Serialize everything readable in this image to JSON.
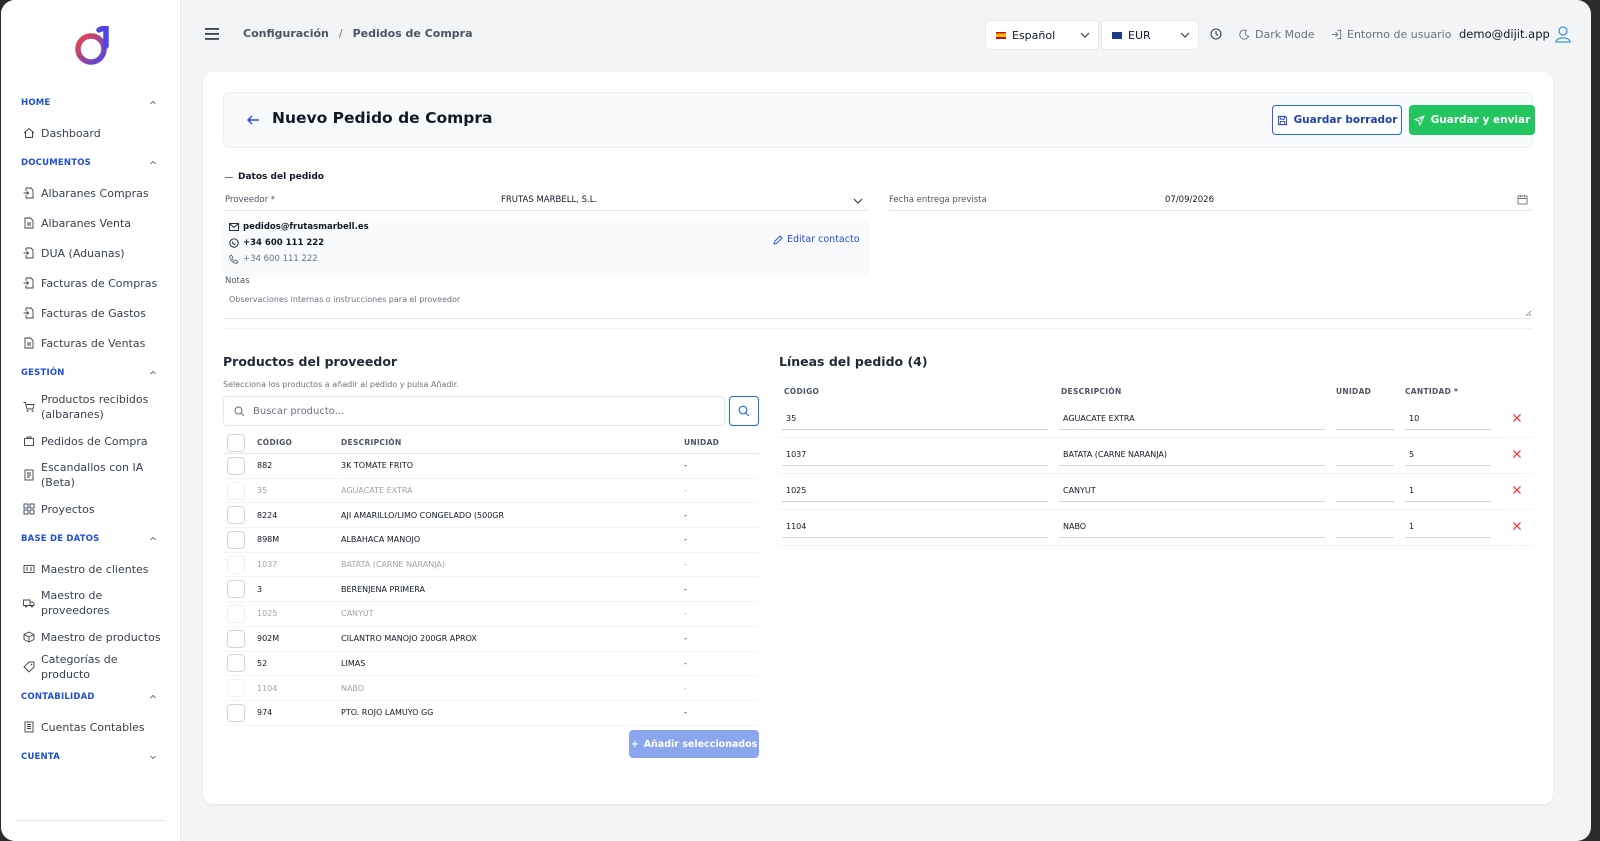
{
  "sidebar": {
    "sections": [
      {
        "title": "HOME",
        "chev": "up",
        "items": [
          {
            "label": "Dashboard",
            "icon": "home-icon"
          }
        ]
      },
      {
        "title": "DOCUMENTOS",
        "chev": "up",
        "items": [
          {
            "label": "Albaranes Compras",
            "icon": "document-in-icon"
          },
          {
            "label": "Albaranes Venta",
            "icon": "document-out-icon"
          },
          {
            "label": "DUA (Aduanas)",
            "icon": "document-in-icon"
          },
          {
            "label": "Facturas de Compras",
            "icon": "document-in-icon"
          },
          {
            "label": "Facturas de Gastos",
            "icon": "document-in-icon"
          },
          {
            "label": "Facturas de Ventas",
            "icon": "document-out-icon"
          }
        ]
      },
      {
        "title": "GESTIÓN",
        "chev": "up",
        "items": [
          {
            "label": "Productos recibidos (albaranes)",
            "icon": "cart-icon",
            "two": true
          },
          {
            "label": "Pedidos de Compra",
            "icon": "bag-icon"
          },
          {
            "label": "Escandallos con IA (Beta)",
            "icon": "list-icon",
            "two": true
          },
          {
            "label": "Proyectos",
            "icon": "grid-icon"
          }
        ]
      },
      {
        "title": "BASE DE DATOS",
        "chev": "up",
        "items": [
          {
            "label": "Maestro de clientes",
            "icon": "id-card-icon"
          },
          {
            "label": "Maestro de proveedores",
            "icon": "truck-icon",
            "two": true
          },
          {
            "label": "Maestro de productos",
            "icon": "box-icon"
          },
          {
            "label": "Categorías de producto",
            "icon": "tag-icon"
          }
        ]
      },
      {
        "title": "CONTABILIDAD",
        "chev": "up",
        "items": [
          {
            "label": "Cuentas Contables",
            "icon": "ledger-icon"
          }
        ]
      },
      {
        "title": "CUENTA",
        "chev": "down",
        "items": []
      }
    ]
  },
  "topbar": {
    "breadcrumb": [
      "Configuración",
      "Pedidos de Compra"
    ],
    "breadcrumb_sep": "/",
    "language": "Español",
    "currency": "EUR",
    "dark_mode": "Dark Mode",
    "user_env": "Entorno de usuario",
    "user": "demo@dijit.app"
  },
  "page": {
    "title": "Nuevo Pedido de Compra",
    "save_draft": "Guardar borrador",
    "save_send": "Guardar y enviar",
    "section_title": "Datos del pedido",
    "supplier_label": "Proveedor *",
    "supplier_value": "FRUTAS MARBELL, S.L.",
    "date_label": "Fecha entrega prevista",
    "date_value": "07/09/2026",
    "contact": {
      "email": "pedidos@frutasmarbell.es",
      "whatsapp": "+34 600 111 222",
      "phone": "+34 600 111 222",
      "edit": "Editar contacto"
    },
    "notes_label": "Notas",
    "notes_placeholder": "Observaciones internas o instrucciones para el proveedor"
  },
  "products": {
    "title": "Productos del proveedor",
    "subtitle": "Selecciona los productos a añadir al pedido y pulsa Añadir.",
    "search_placeholder": "Buscar producto...",
    "headers": {
      "code": "CÓDIGO",
      "description": "DESCRIPCIÓN",
      "unit": "UNIDAD"
    },
    "rows": [
      {
        "code": "882",
        "description": "3K TOMATE FRITO",
        "unit": "-",
        "disabled": false
      },
      {
        "code": "35",
        "description": "AGUACATE EXTRA",
        "unit": "-",
        "disabled": true
      },
      {
        "code": "8224",
        "description": "AJI AMARILLO/LIMO CONGELADO (500GR",
        "unit": "-",
        "disabled": false
      },
      {
        "code": "898M",
        "description": "ALBAHACA MANOJO",
        "unit": "-",
        "disabled": false
      },
      {
        "code": "1037",
        "description": "BATATA (CARNE NARANJA)",
        "unit": "-",
        "disabled": true
      },
      {
        "code": "3",
        "description": "BERENJENA PRIMERA",
        "unit": "-",
        "disabled": false
      },
      {
        "code": "1025",
        "description": "CANYUT",
        "unit": "-",
        "disabled": true
      },
      {
        "code": "902M",
        "description": "CILANTRO MANOJO 200GR APROX",
        "unit": "-",
        "disabled": false
      },
      {
        "code": "52",
        "description": "LIMAS",
        "unit": "-",
        "disabled": false
      },
      {
        "code": "1104",
        "description": "NABO",
        "unit": "-",
        "disabled": true
      },
      {
        "code": "974",
        "description": "PTO. ROJO LAMUYO GG",
        "unit": "-",
        "disabled": false
      }
    ],
    "add_button": "Añadir seleccionados"
  },
  "lines": {
    "title": "Líneas del pedido (4)",
    "headers": {
      "code": "CÓDIGO",
      "description": "DESCRIPCIÓN",
      "unit": "UNIDAD",
      "qty": "CANTIDAD *"
    },
    "rows": [
      {
        "code": "35",
        "description": "AGUACATE EXTRA",
        "unit": "",
        "qty": "10"
      },
      {
        "code": "1037",
        "description": "BATATA (CARNE NARANJA)",
        "unit": "",
        "qty": "5"
      },
      {
        "code": "1025",
        "description": "CANYUT",
        "unit": "",
        "qty": "1"
      },
      {
        "code": "1104",
        "description": "NABO",
        "unit": "",
        "qty": "1"
      }
    ]
  },
  "colors": {
    "accent": "#1d4ed8",
    "success": "#22c55e",
    "danger": "#ef4444"
  }
}
